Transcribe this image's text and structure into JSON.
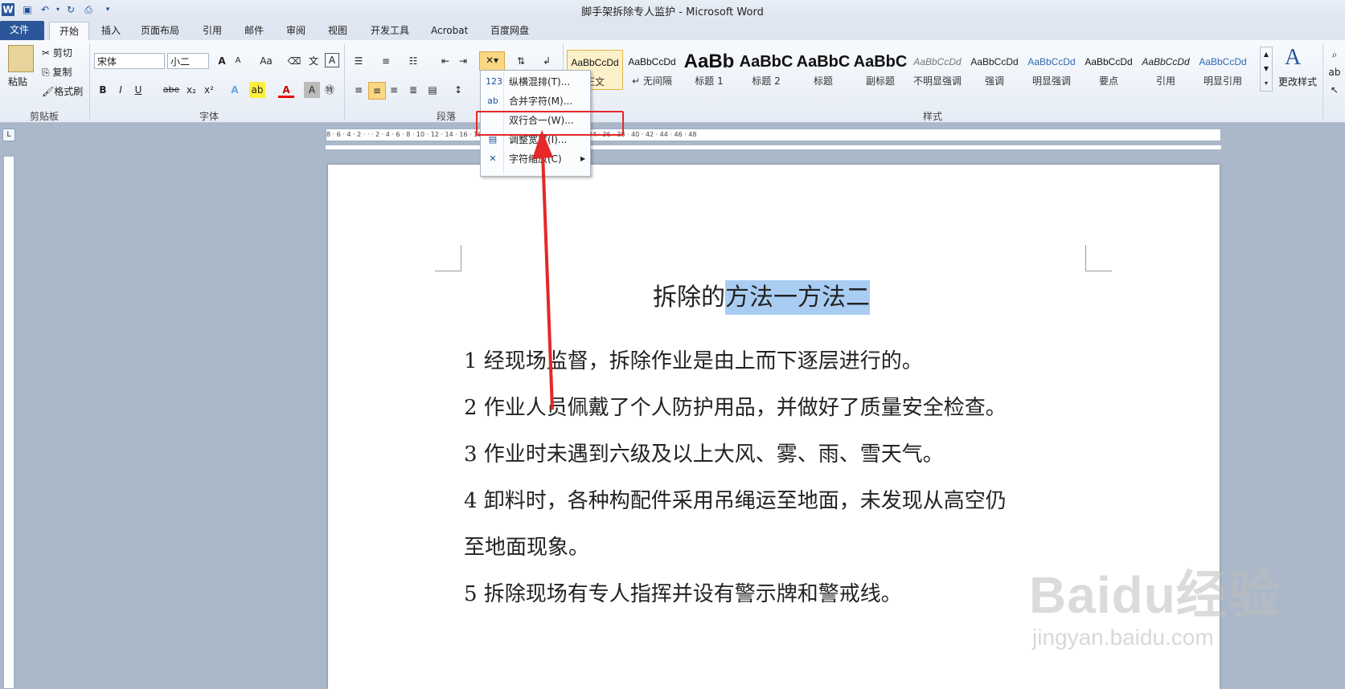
{
  "window": {
    "title": "脚手架拆除专人监护 - Microsoft Word"
  },
  "qat": {
    "word_icon": "word-app-icon",
    "save": "save-icon",
    "undo": "undo-icon",
    "redo": "redo-icon",
    "preview": "print-preview-icon",
    "customize": "customize-qat-icon"
  },
  "tabs": [
    "文件",
    "开始",
    "插入",
    "页面布局",
    "引用",
    "邮件",
    "审阅",
    "视图",
    "开发工具",
    "Acrobat",
    "百度网盘"
  ],
  "clipboard": {
    "paste": "粘贴",
    "cut": "剪切",
    "copy": "复制",
    "format_painter": "格式刷",
    "label": "剪贴板"
  },
  "font": {
    "name": "宋体",
    "size": "小二",
    "label": "字体",
    "grow": "A",
    "shrink": "A",
    "case": "Aa",
    "bold": "B",
    "italic": "I",
    "underline": "U",
    "strike": "abe",
    "sub": "x₂",
    "sup": "x²",
    "color_letter": "A",
    "shade_letter": "A"
  },
  "paragraph": {
    "label": "段落"
  },
  "styles": {
    "label": "样式",
    "items": [
      {
        "sample": "AaBbCcDd",
        "name": "正文"
      },
      {
        "sample": "AaBbCcDd",
        "name": "↵ 无间隔"
      },
      {
        "sample": "AaBb",
        "name": "标题 1"
      },
      {
        "sample": "AaBbC",
        "name": "标题 2"
      },
      {
        "sample": "AaBbC",
        "name": "标题"
      },
      {
        "sample": "AaBbC",
        "name": "副标题"
      },
      {
        "sample": "AaBbCcDd",
        "name": "不明显强调"
      },
      {
        "sample": "AaBbCcDd",
        "name": "强调"
      },
      {
        "sample": "AaBbCcDd",
        "name": "明显强调"
      },
      {
        "sample": "AaBbCcDd",
        "name": "要点"
      },
      {
        "sample": "AaBbCcDd",
        "name": "引用"
      },
      {
        "sample": "AaBbCcDd",
        "name": "明显引用"
      }
    ],
    "change": "更改样式"
  },
  "menu": {
    "items": [
      {
        "icon": "123",
        "label": "纵横混排(T)..."
      },
      {
        "icon": "ab",
        "label": "合并字符(M)..."
      },
      {
        "icon": "",
        "label": "双行合一(W)..."
      },
      {
        "icon": "▤",
        "label": "调整宽度(I)..."
      },
      {
        "icon": "✕",
        "label": "字符缩放(C)"
      }
    ]
  },
  "ruler": {
    "marks": "8 · 6 · 4 · 2 · · · 2 · 4 · 6 · 8 · 10 · 12 · 14 · 16 · 18 · 20 · 22 · 24 · 26 · 28 · 30 · 32 · 34 · 36 · 38 · 40 · 42 · 44 · 46 · 48"
  },
  "document": {
    "title_plain": "拆除的",
    "title_selected": "方法一方法二",
    "lines": [
      "1 经现场监督，拆除作业是由上而下逐层进行的。",
      "2 作业人员佩戴了个人防护用品，并做好了质量安全检查。",
      "3 作业时未遇到六级及以上大风、雾、雨、雪天气。",
      "4  卸料时，各种构配件采用吊绳运至地面，未发现从高空仍",
      "至地面现象。",
      "5 拆除现场有专人指挥并设有警示牌和警戒线。"
    ]
  },
  "watermark": {
    "brand": "Baidu经验",
    "url": "jingyan.baidu.com"
  },
  "colors": {
    "accent": "#2b579a",
    "selection": "#a9cdf2",
    "annotation": "#e52828"
  }
}
